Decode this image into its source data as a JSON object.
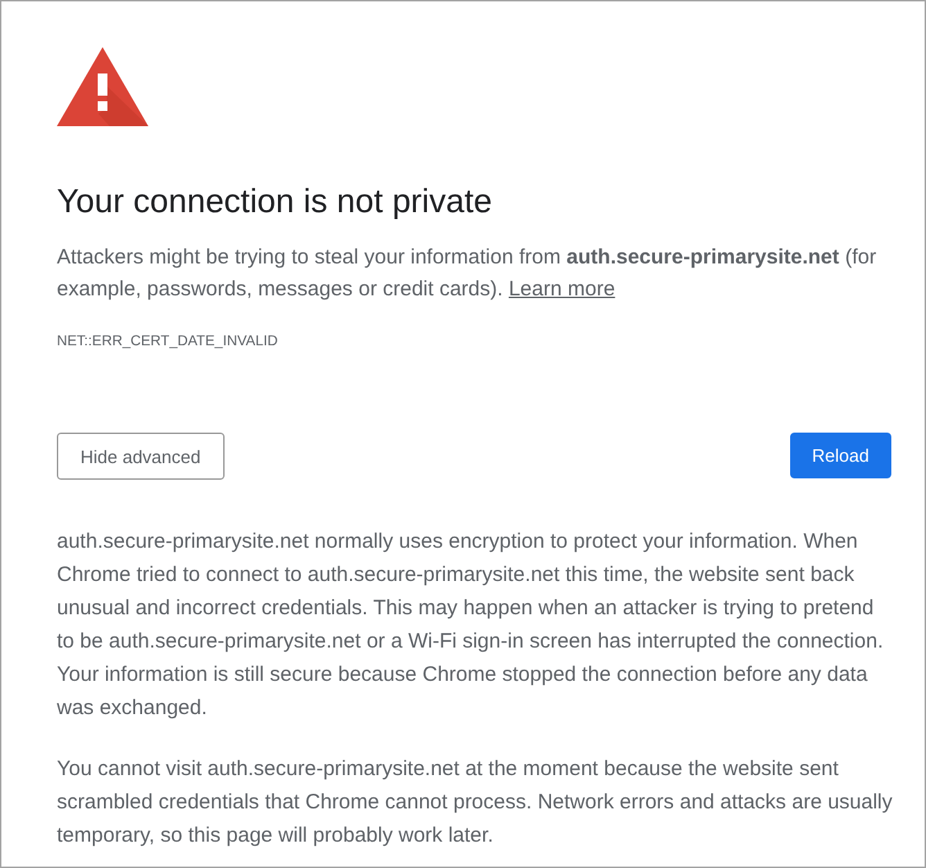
{
  "heading": "Your connection is not private",
  "intro": {
    "text": "Attackers might be trying to steal your information from **auth.secure-primarysite.net** (for example, passwords, messages or credit cards).",
    "link": "Learn more"
  },
  "error_code": "NET::ERR_CERT_DATE_INVALID",
  "buttons": [
    {
      "label": "Hide advanced",
      "kind": "secondary"
    },
    {
      "label": "Reload",
      "kind": "primary"
    }
  ],
  "details": [
    "auth.secure-primarysite.net normally uses encryption to protect your information. When Chrome tried to connect to auth.secure-primarysite.net this time, the website sent back unusual and incorrect credentials. This may happen when an attacker is trying to pretend to be auth.secure-primarysite.net or a Wi-Fi sign-in screen has interrupted the connection. Your information is still secure because Chrome stopped the connection before any data was exchanged.",
    "You cannot visit auth.secure-primarysite.net at the moment because the website sent scrambled credentials that Chrome cannot process. Network errors and attacks are usually temporary, so this page will probably work later."
  ]
}
